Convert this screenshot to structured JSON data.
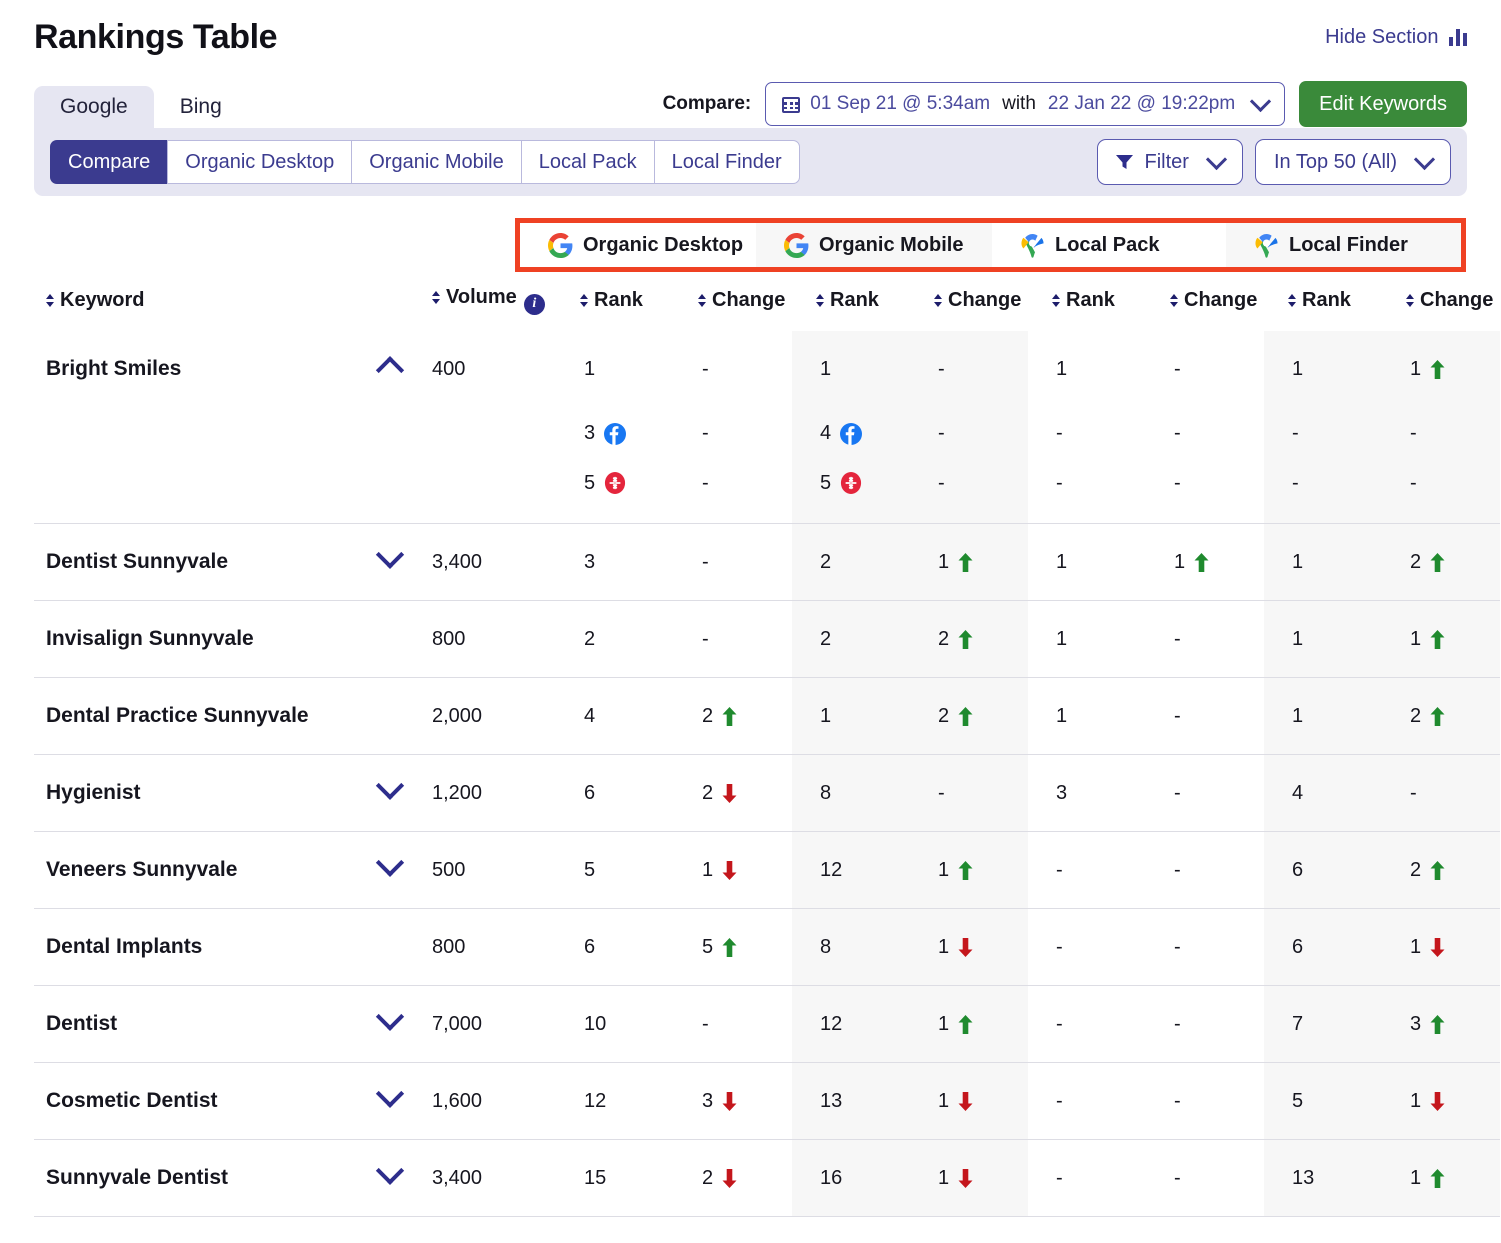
{
  "header": {
    "title": "Rankings Table",
    "hide_section_label": "Hide Section",
    "hide_section_icon": "bar-chart-icon"
  },
  "engine_tabs": [
    {
      "label": "Google",
      "active": true
    },
    {
      "label": "Bing",
      "active": false
    }
  ],
  "compare": {
    "label": "Compare:",
    "calendar_icon": "calendar-icon",
    "date_from": "01 Sep 21 @ 5:34am",
    "with_label": "with",
    "date_to": "22 Jan 22 @ 19:22pm",
    "chevron_icon": "chevron-down-icon"
  },
  "edit_keywords_button": "Edit Keywords",
  "view_tabs": [
    {
      "label": "Compare",
      "active": true
    },
    {
      "label": "Organic Desktop",
      "active": false
    },
    {
      "label": "Organic Mobile",
      "active": false
    },
    {
      "label": "Local Pack",
      "active": false
    },
    {
      "label": "Local Finder",
      "active": false
    }
  ],
  "filters": {
    "filter_icon": "funnel-icon",
    "filter_label": "Filter",
    "top_label": "In Top 50 (All)",
    "chevron_icon": "chevron-down-icon"
  },
  "column_groups": [
    {
      "label": "Organic Desktop",
      "icon": "google-icon"
    },
    {
      "label": "Organic Mobile",
      "icon": "google-icon"
    },
    {
      "label": "Local Pack",
      "icon": "google-maps-pin-icon"
    },
    {
      "label": "Local Finder",
      "icon": "google-maps-pin-icon"
    }
  ],
  "columns": {
    "keyword": "Keyword",
    "volume": "Volume",
    "volume_info_icon": "info-icon",
    "rank": "Rank",
    "change": "Change"
  },
  "colors": {
    "accent": "#3b3b8f",
    "highlight_box": "#ef4123",
    "green_button": "#3a8a3a",
    "up_arrow": "#1f8a2e",
    "down_arrow": "#c4161c"
  },
  "rows": [
    {
      "keyword": "Bright Smiles",
      "chevron": "up",
      "volume": "400",
      "cells": [
        {
          "rank": "1",
          "change": "-",
          "dir": "none"
        },
        {
          "rank": "1",
          "change": "-",
          "dir": "none"
        },
        {
          "rank": "1",
          "change": "-",
          "dir": "none"
        },
        {
          "rank": "1",
          "change": "1",
          "dir": "up"
        }
      ],
      "subrows": [
        {
          "source": "facebook-icon",
          "cells": [
            {
              "rank": "3",
              "change": "-",
              "dir": "none"
            },
            {
              "rank": "4",
              "change": "-",
              "dir": "none"
            },
            {
              "rank": "-",
              "change": "-",
              "dir": "none"
            },
            {
              "rank": "-",
              "change": "-",
              "dir": "none"
            }
          ]
        },
        {
          "source": "yelp-icon",
          "cells": [
            {
              "rank": "5",
              "change": "-",
              "dir": "none"
            },
            {
              "rank": "5",
              "change": "-",
              "dir": "none"
            },
            {
              "rank": "-",
              "change": "-",
              "dir": "none"
            },
            {
              "rank": "-",
              "change": "-",
              "dir": "none"
            }
          ]
        }
      ]
    },
    {
      "keyword": "Dentist Sunnyvale",
      "chevron": "down",
      "volume": "3,400",
      "cells": [
        {
          "rank": "3",
          "change": "-",
          "dir": "none"
        },
        {
          "rank": "2",
          "change": "1",
          "dir": "up"
        },
        {
          "rank": "1",
          "change": "1",
          "dir": "up"
        },
        {
          "rank": "1",
          "change": "2",
          "dir": "up"
        }
      ],
      "subrows": []
    },
    {
      "keyword": "Invisalign Sunnyvale",
      "chevron": "none",
      "volume": "800",
      "cells": [
        {
          "rank": "2",
          "change": "-",
          "dir": "none"
        },
        {
          "rank": "2",
          "change": "2",
          "dir": "up"
        },
        {
          "rank": "1",
          "change": "-",
          "dir": "none"
        },
        {
          "rank": "1",
          "change": "1",
          "dir": "up"
        }
      ],
      "subrows": []
    },
    {
      "keyword": "Dental Practice Sunnyvale",
      "chevron": "none",
      "volume": "2,000",
      "cells": [
        {
          "rank": "4",
          "change": "2",
          "dir": "up"
        },
        {
          "rank": "1",
          "change": "2",
          "dir": "up"
        },
        {
          "rank": "1",
          "change": "-",
          "dir": "none"
        },
        {
          "rank": "1",
          "change": "2",
          "dir": "up"
        }
      ],
      "subrows": []
    },
    {
      "keyword": "Hygienist",
      "chevron": "down",
      "volume": "1,200",
      "cells": [
        {
          "rank": "6",
          "change": "2",
          "dir": "down"
        },
        {
          "rank": "8",
          "change": "-",
          "dir": "none"
        },
        {
          "rank": "3",
          "change": "-",
          "dir": "none"
        },
        {
          "rank": "4",
          "change": "-",
          "dir": "none"
        }
      ],
      "subrows": []
    },
    {
      "keyword": "Veneers Sunnyvale",
      "chevron": "down",
      "volume": "500",
      "cells": [
        {
          "rank": "5",
          "change": "1",
          "dir": "down"
        },
        {
          "rank": "12",
          "change": "1",
          "dir": "up"
        },
        {
          "rank": "-",
          "change": "-",
          "dir": "none"
        },
        {
          "rank": "6",
          "change": "2",
          "dir": "up"
        }
      ],
      "subrows": []
    },
    {
      "keyword": "Dental Implants",
      "chevron": "none",
      "volume": "800",
      "cells": [
        {
          "rank": "6",
          "change": "5",
          "dir": "up"
        },
        {
          "rank": "8",
          "change": "1",
          "dir": "down"
        },
        {
          "rank": "-",
          "change": "-",
          "dir": "none"
        },
        {
          "rank": "6",
          "change": "1",
          "dir": "down"
        }
      ],
      "subrows": []
    },
    {
      "keyword": "Dentist",
      "chevron": "down",
      "volume": "7,000",
      "cells": [
        {
          "rank": "10",
          "change": "-",
          "dir": "none"
        },
        {
          "rank": "12",
          "change": "1",
          "dir": "up"
        },
        {
          "rank": "-",
          "change": "-",
          "dir": "none"
        },
        {
          "rank": "7",
          "change": "3",
          "dir": "up"
        }
      ],
      "subrows": []
    },
    {
      "keyword": "Cosmetic Dentist",
      "chevron": "down",
      "volume": "1,600",
      "cells": [
        {
          "rank": "12",
          "change": "3",
          "dir": "down"
        },
        {
          "rank": "13",
          "change": "1",
          "dir": "down"
        },
        {
          "rank": "-",
          "change": "-",
          "dir": "none"
        },
        {
          "rank": "5",
          "change": "1",
          "dir": "down"
        }
      ],
      "subrows": []
    },
    {
      "keyword": "Sunnyvale Dentist",
      "chevron": "down",
      "volume": "3,400",
      "cells": [
        {
          "rank": "15",
          "change": "2",
          "dir": "down"
        },
        {
          "rank": "16",
          "change": "1",
          "dir": "down"
        },
        {
          "rank": "-",
          "change": "-",
          "dir": "none"
        },
        {
          "rank": "13",
          "change": "1",
          "dir": "up"
        }
      ],
      "subrows": []
    }
  ]
}
